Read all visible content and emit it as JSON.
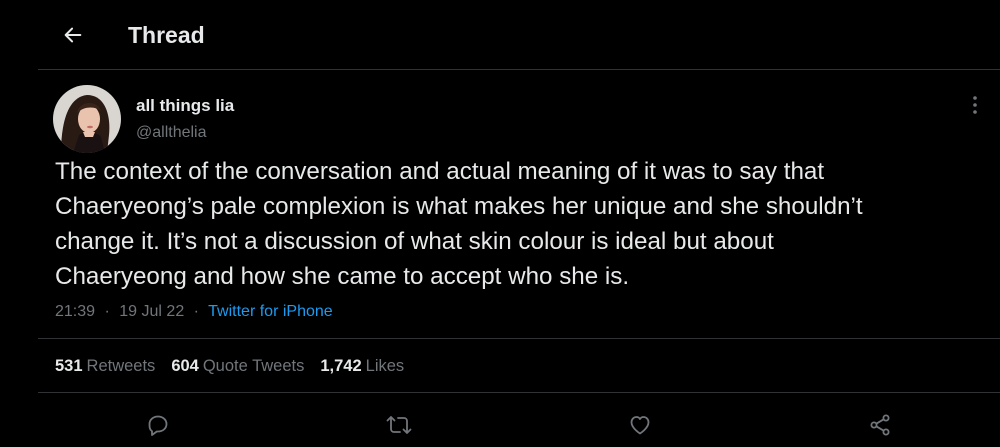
{
  "header": {
    "title": "Thread",
    "back_icon": "arrow-left-icon"
  },
  "tweet": {
    "author": {
      "display_name": "all things lia",
      "handle": "@allthelia"
    },
    "more_icon": "more-vertical-icon",
    "text": "The context of the conversation and actual meaning of it was to say that\nChaeryeong’s pale complexion is what makes her unique and she shouldn’t\nchange it. It’s not a discussion of what skin colour is ideal but about\nChaeryeong and how she came to accept who she is.",
    "time": "21:39",
    "date": "19 Jul 22",
    "separator": "·",
    "source": "Twitter for iPhone"
  },
  "stats": {
    "retweets": {
      "count": "531",
      "label": "Retweets"
    },
    "quote_tweets": {
      "count": "604",
      "label": "Quote Tweets"
    },
    "likes": {
      "count": "1,742",
      "label": "Likes"
    }
  },
  "actions": [
    "reply-icon",
    "retweet-icon",
    "like-icon",
    "share-icon"
  ],
  "colors": {
    "background": "#000000",
    "text_primary": "#e7e9ea",
    "text_secondary": "#71767b",
    "accent": "#1d9bf0",
    "divider": "#2f3336"
  }
}
